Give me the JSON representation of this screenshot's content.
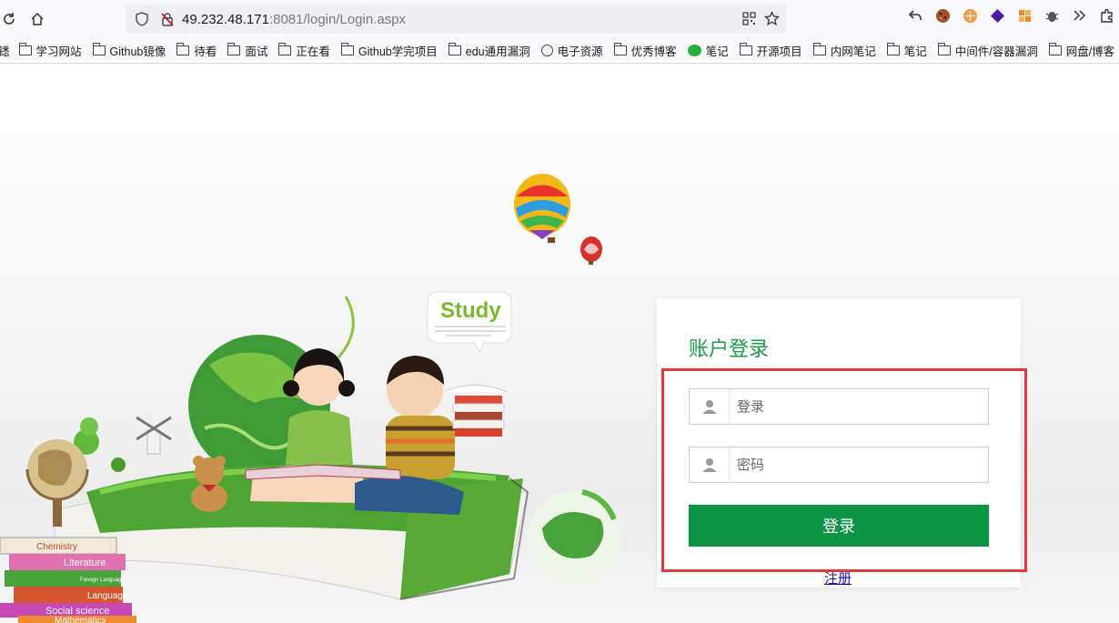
{
  "browser": {
    "url_host": "49.232.48.171",
    "url_rest": ":8081/login/Login.aspx"
  },
  "bookmarks": [
    {
      "label": "学习网站",
      "icon": "folder-icon"
    },
    {
      "label": "Github镜像",
      "icon": "folder-icon"
    },
    {
      "label": "待看",
      "icon": "folder-icon"
    },
    {
      "label": "面试",
      "icon": "folder-icon"
    },
    {
      "label": "正在看",
      "icon": "folder-icon"
    },
    {
      "label": "Github学完项目",
      "icon": "folder-icon"
    },
    {
      "label": "edu通用漏洞",
      "icon": "folder-icon"
    },
    {
      "label": "电子资源",
      "icon": "globe-icon"
    },
    {
      "label": "优秀博客",
      "icon": "folder-icon"
    },
    {
      "label": "笔记",
      "icon": "wechat-icon"
    },
    {
      "label": "开源项目",
      "icon": "folder-icon"
    },
    {
      "label": "内网笔记",
      "icon": "folder-icon"
    },
    {
      "label": "笔记",
      "icon": "folder-icon"
    },
    {
      "label": "中间件/容器漏洞",
      "icon": "folder-icon"
    },
    {
      "label": "网盘/博客",
      "icon": "folder-icon"
    }
  ],
  "bookmark_fragment": "鏭",
  "hero": {
    "badge_text": "Study",
    "book_spines": [
      "Chemistry",
      "Literature",
      "Foreign Language",
      "Language",
      "Social science",
      "Mathematics"
    ]
  },
  "login": {
    "title": "账户登录",
    "username_placeholder": "登录",
    "password_placeholder": "密码",
    "submit_label": "登录",
    "register_label": "注册"
  },
  "colors": {
    "accent": "#0b9443",
    "title_green": "#1d9a4b",
    "highlight_red": "#e0393e"
  }
}
